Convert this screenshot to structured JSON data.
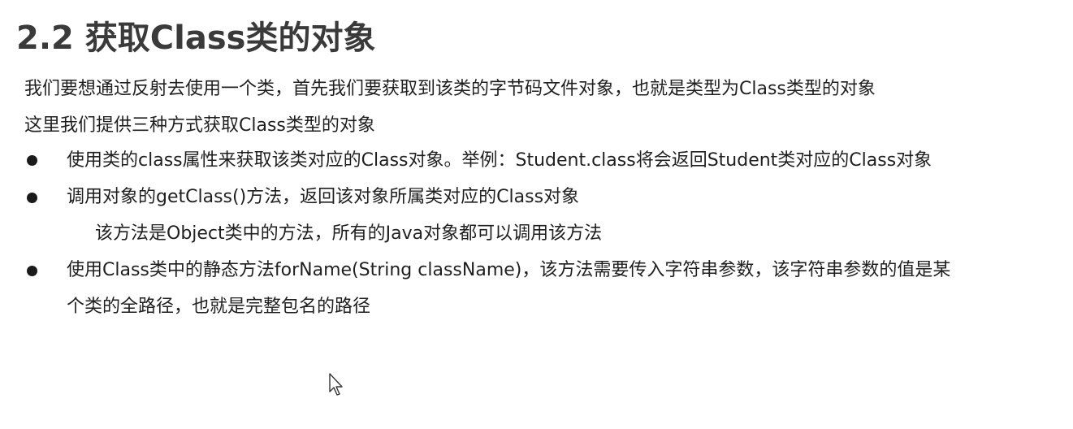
{
  "slide": {
    "title": "2.2 获取Class类的对象",
    "intro_lines": [
      "我们要想通过反射去使用一个类，首先我们要获取到该类的字节码文件对象，也就是类型为Class类型的对象",
      "这里我们提供三种方式获取Class类型的对象"
    ],
    "bullets": [
      {
        "text": "使用类的class属性来获取该类对应的Class对象。举例：Student.class将会返回Student类对应的Class对象"
      },
      {
        "text": "调用对象的getClass()方法，返回该对象所属类对应的Class对象",
        "sub": "该方法是Object类中的方法，所有的Java对象都可以调用该方法"
      },
      {
        "text": "使用Class类中的静态方法forName(String className)，该方法需要传入字符串参数，该字符串参数的值是某",
        "continuation": "个类的全路径，也就是完整包名的路径"
      }
    ]
  },
  "icons": {
    "cursor": "mouse-pointer-icon",
    "bullet": "bullet-dot-icon"
  }
}
